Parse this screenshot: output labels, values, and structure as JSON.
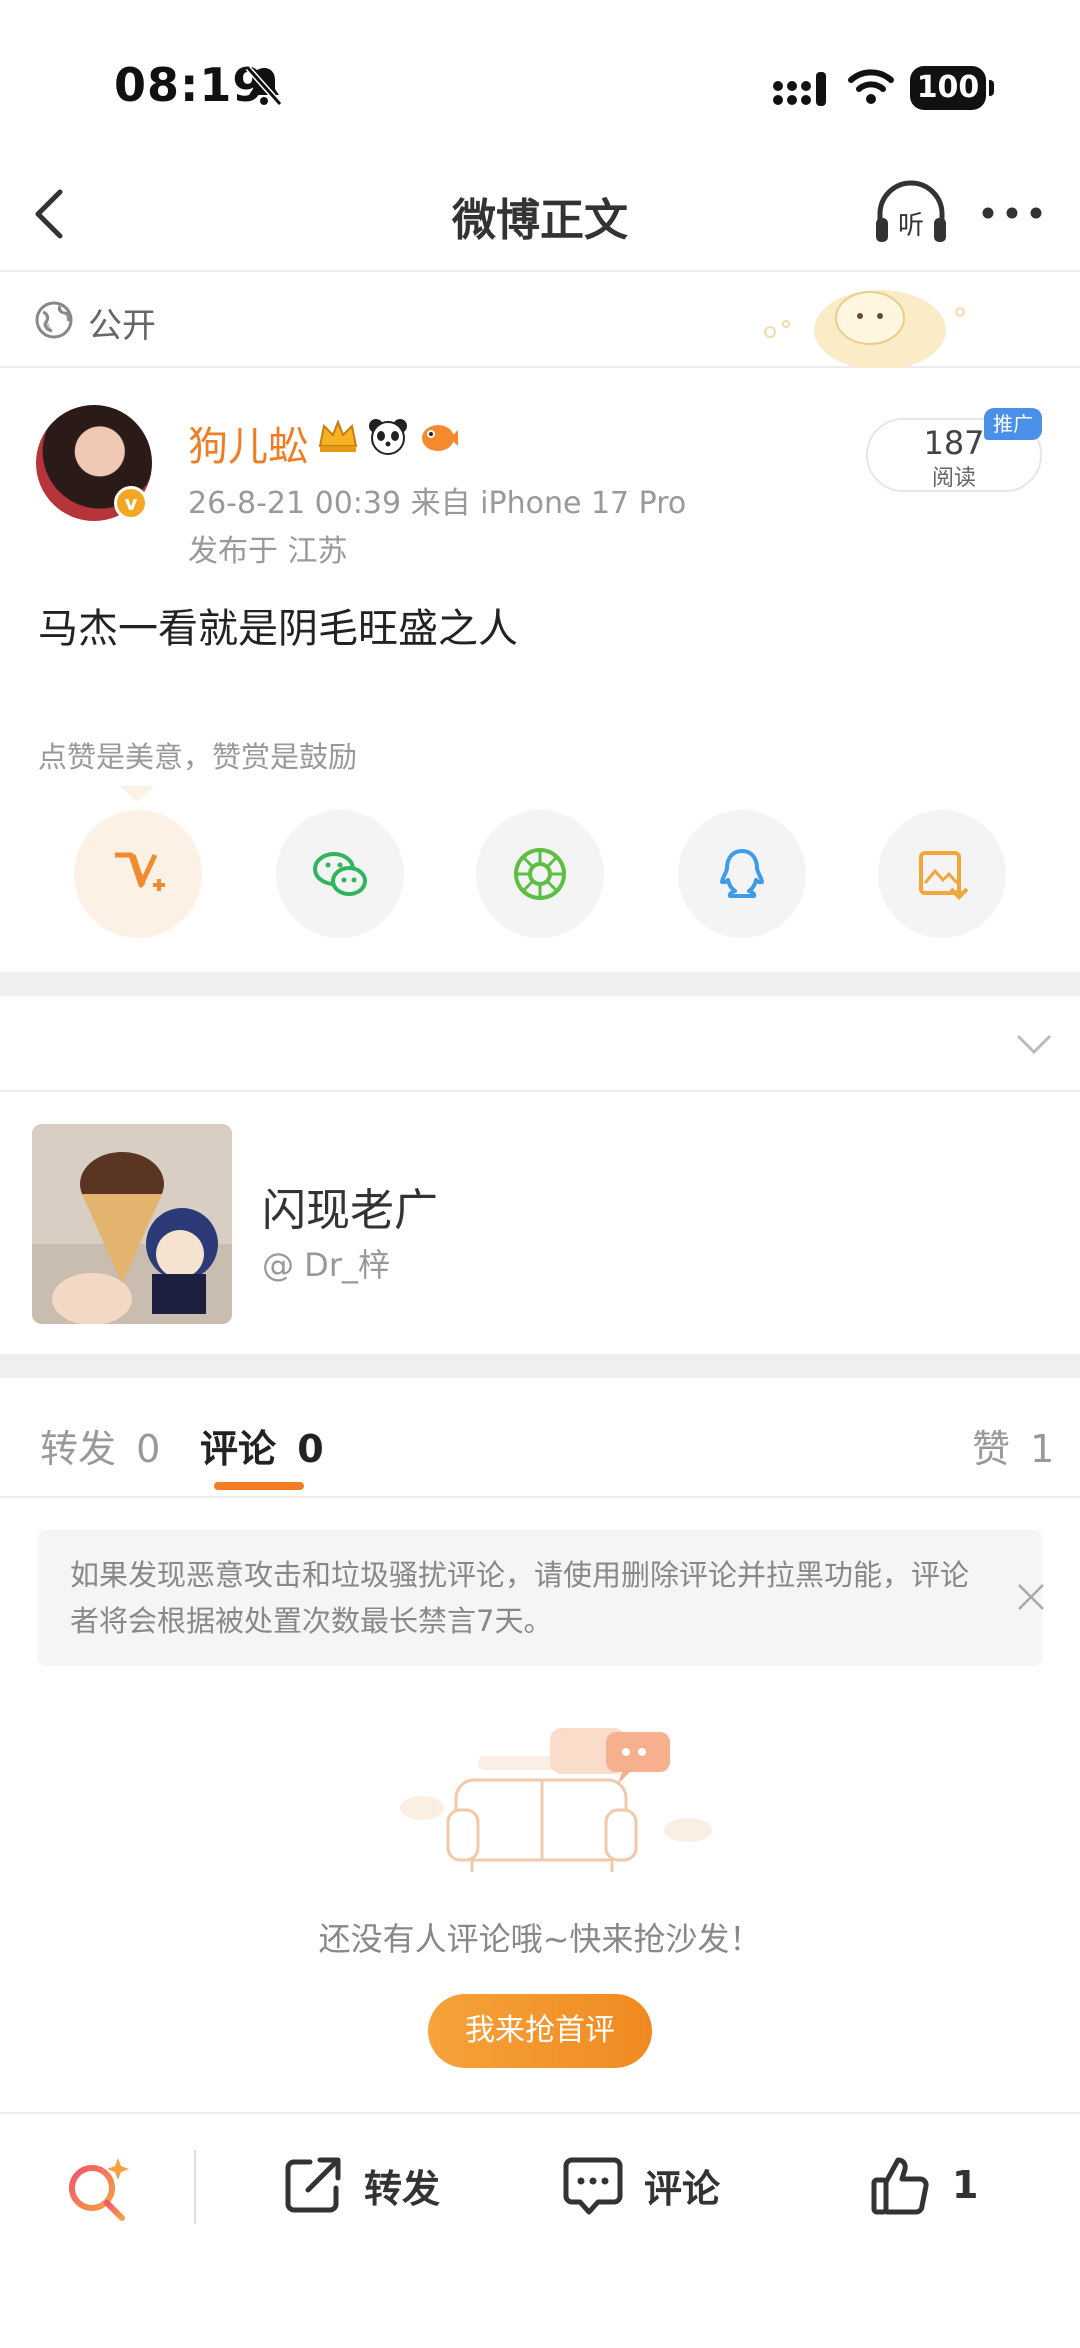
{
  "status_bar": {
    "time": "08:19",
    "battery": "100"
  },
  "nav": {
    "title": "微博正文",
    "listen_label": "听"
  },
  "visibility": {
    "label": "公开"
  },
  "post": {
    "author": "狗儿蚣",
    "meta": "26-8-21 00:39  来自 iPhone 17 Pro",
    "location": "发布于 江苏",
    "read_count": "187",
    "read_label": "阅读",
    "promo_tag": "推广",
    "text": "马杰一看就是阴毛旺盛之人",
    "reward_hint": "点赞是美意，赞赏是鼓励",
    "share_targets": [
      "weibo-reward-icon",
      "wechat-icon",
      "moments-icon",
      "qq-icon",
      "save-image-icon"
    ]
  },
  "source": {
    "name": "闪现老广",
    "handle": "@ Dr_梓"
  },
  "tabs": {
    "repost": "转发",
    "repost_count": "0",
    "comment": "评论",
    "comment_count": "0",
    "like": "赞",
    "like_count": "1"
  },
  "notice": {
    "text": "如果发现恶意攻击和垃圾骚扰评论，请使用删除评论并拉黑功能，评论者将会根据被处置次数最长禁言7天。"
  },
  "empty": {
    "text": "还没有人评论哦~快来抢沙发！",
    "button": "我来抢首评"
  },
  "bottom_bar": {
    "repost": "转发",
    "comment": "评论",
    "like_count": "1"
  },
  "colors": {
    "accent": "#f07d24",
    "promo": "#4a8fe8",
    "button": "#f7a23b"
  }
}
